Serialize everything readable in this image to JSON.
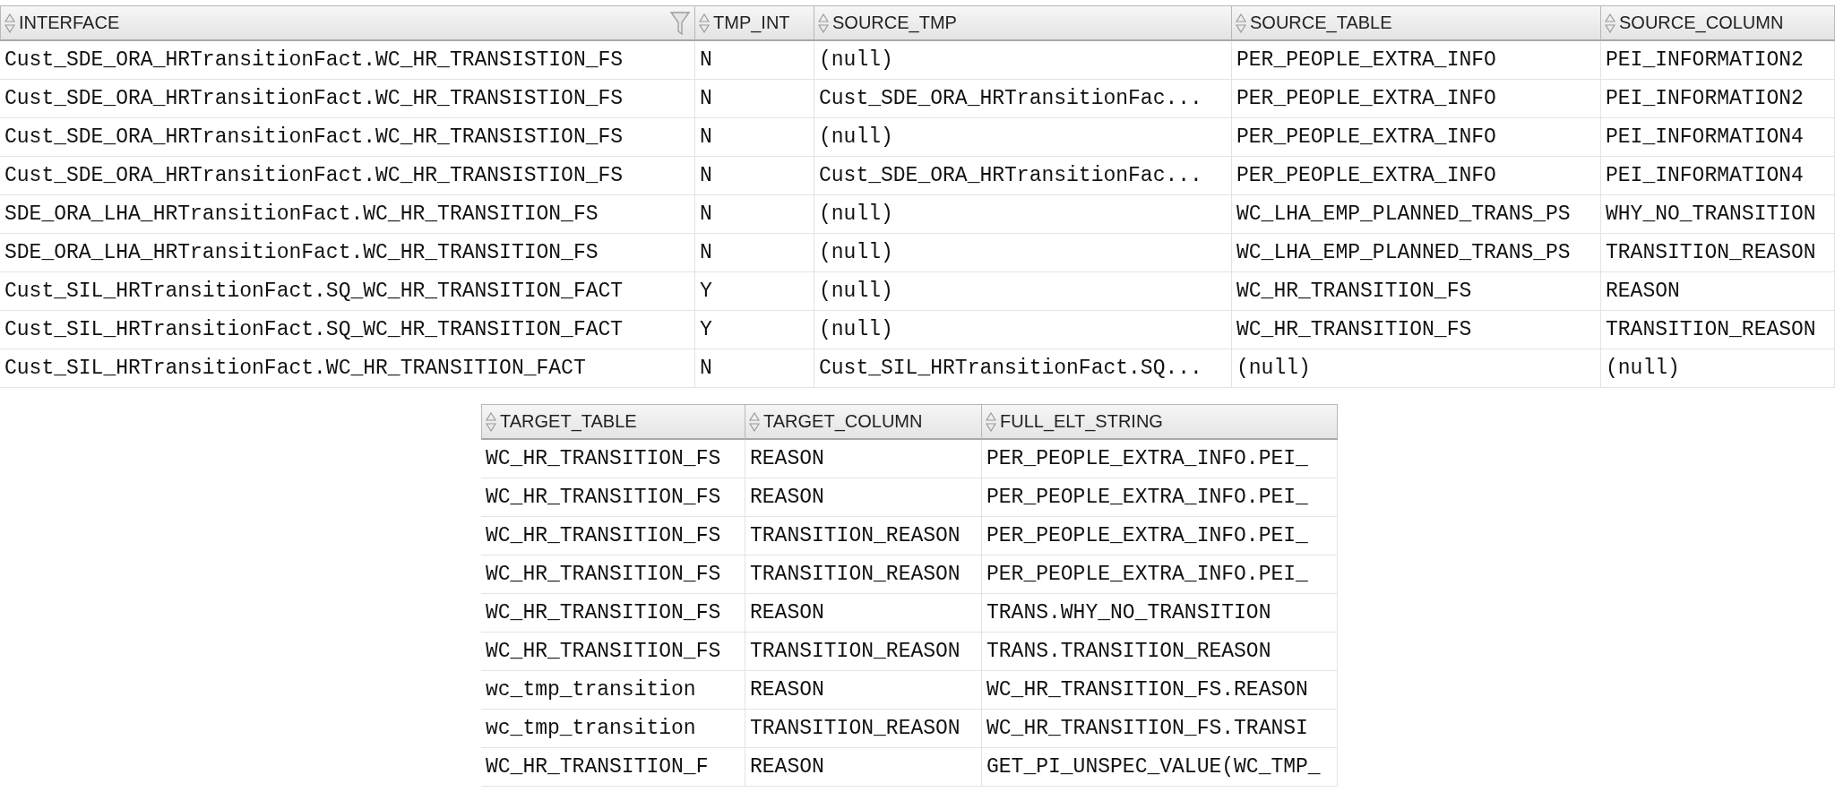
{
  "top_table": {
    "columns": [
      {
        "label": "INTERFACE",
        "filter": true
      },
      {
        "label": "TMP_INT",
        "filter": false
      },
      {
        "label": "SOURCE_TMP",
        "filter": false
      },
      {
        "label": "SOURCE_TABLE",
        "filter": false
      },
      {
        "label": "SOURCE_COLUMN",
        "filter": false
      }
    ],
    "rows": [
      [
        "Cust_SDE_ORA_HRTransitionFact.WC_HR_TRANSISTION_FS",
        "N",
        "(null)",
        "PER_PEOPLE_EXTRA_INFO",
        "PEI_INFORMATION2"
      ],
      [
        "Cust_SDE_ORA_HRTransitionFact.WC_HR_TRANSISTION_FS",
        "N",
        "Cust_SDE_ORA_HRTransitionFac...",
        "PER_PEOPLE_EXTRA_INFO",
        "PEI_INFORMATION2"
      ],
      [
        "Cust_SDE_ORA_HRTransitionFact.WC_HR_TRANSISTION_FS",
        "N",
        "(null)",
        "PER_PEOPLE_EXTRA_INFO",
        "PEI_INFORMATION4"
      ],
      [
        "Cust_SDE_ORA_HRTransitionFact.WC_HR_TRANSISTION_FS",
        "N",
        "Cust_SDE_ORA_HRTransitionFac...",
        "PER_PEOPLE_EXTRA_INFO",
        "PEI_INFORMATION4"
      ],
      [
        "SDE_ORA_LHA_HRTransitionFact.WC_HR_TRANSITION_FS",
        "N",
        "(null)",
        "WC_LHA_EMP_PLANNED_TRANS_PS",
        "WHY_NO_TRANSITION"
      ],
      [
        "SDE_ORA_LHA_HRTransitionFact.WC_HR_TRANSITION_FS",
        "N",
        "(null)",
        "WC_LHA_EMP_PLANNED_TRANS_PS",
        "TRANSITION_REASON"
      ],
      [
        "Cust_SIL_HRTransitionFact.SQ_WC_HR_TRANSITION_FACT",
        "Y",
        "(null)",
        "WC_HR_TRANSITION_FS",
        "REASON"
      ],
      [
        "Cust_SIL_HRTransitionFact.SQ_WC_HR_TRANSITION_FACT",
        "Y",
        "(null)",
        "WC_HR_TRANSITION_FS",
        "TRANSITION_REASON"
      ],
      [
        "Cust_SIL_HRTransitionFact.WC_HR_TRANSITION_FACT",
        "N",
        "Cust_SIL_HRTransitionFact.SQ...",
        "(null)",
        "(null)"
      ]
    ]
  },
  "bottom_table": {
    "columns": [
      {
        "label": "TARGET_TABLE",
        "filter": false
      },
      {
        "label": "TARGET_COLUMN",
        "filter": false
      },
      {
        "label": "FULL_ELT_STRING",
        "filter": false
      }
    ],
    "rows": [
      [
        "WC_HR_TRANSITION_FS",
        "REASON",
        "PER_PEOPLE_EXTRA_INFO.PEI_"
      ],
      [
        "WC_HR_TRANSITION_FS",
        "REASON",
        "PER_PEOPLE_EXTRA_INFO.PEI_"
      ],
      [
        "WC_HR_TRANSITION_FS",
        "TRANSITION_REASON",
        "PER_PEOPLE_EXTRA_INFO.PEI_"
      ],
      [
        "WC_HR_TRANSITION_FS",
        "TRANSITION_REASON",
        "PER_PEOPLE_EXTRA_INFO.PEI_"
      ],
      [
        "WC_HR_TRANSITION_FS",
        "REASON",
        "TRANS.WHY_NO_TRANSITION"
      ],
      [
        "WC_HR_TRANSITION_FS",
        "TRANSITION_REASON",
        "TRANS.TRANSITION_REASON"
      ],
      [
        "wc_tmp_transition",
        "REASON",
        "WC_HR_TRANSITION_FS.REASON"
      ],
      [
        "wc_tmp_transition",
        "TRANSITION_REASON",
        "WC_HR_TRANSITION_FS.TRANSI"
      ],
      [
        "WC_HR_TRANSITION_F",
        "REASON",
        "GET_PI_UNSPEC_VALUE(WC_TMP_"
      ]
    ]
  }
}
